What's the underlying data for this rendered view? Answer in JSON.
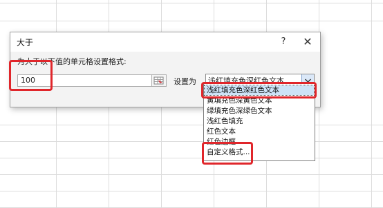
{
  "dialog": {
    "title": "大于",
    "help_label": "?",
    "close_label": "✕",
    "instruction": "为大于以下值的单元格设置格式:",
    "value": "100",
    "format_label": "设置为",
    "format_selected": "浅红填充色深红色文本"
  },
  "dropdown": {
    "options": [
      "浅红填充色深红色文本",
      "黄填充色深黄色文本",
      "绿填充色深绿色文本",
      "浅红色填充",
      "红色文本",
      "红色边框",
      "自定义格式..."
    ]
  },
  "colors": {
    "annotation_red": "#e0262b",
    "selection_blue": "#cde3f7"
  }
}
